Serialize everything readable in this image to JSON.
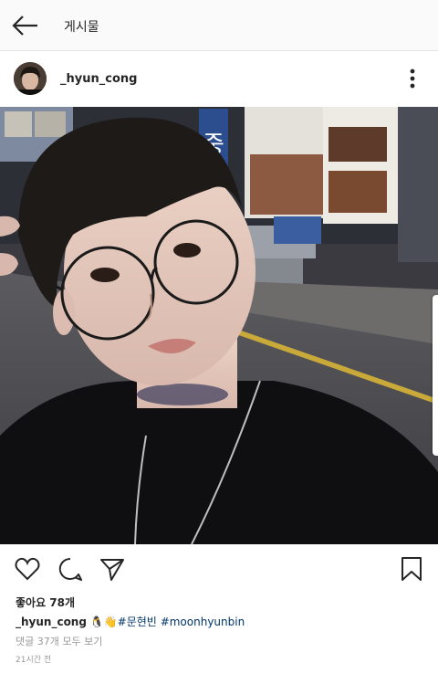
{
  "header": {
    "title": "게시물",
    "back_icon": "arrow-left-icon"
  },
  "post": {
    "username": "_hyun_cong",
    "more_icon": "more-vertical-icon",
    "photo_alt": "selfie photo",
    "shop_sign_text": "중",
    "likes": "좋아요 78개",
    "caption": {
      "username": "_hyun_cong",
      "emojis": "🐧👋",
      "hashtag1": "#문현빈",
      "hashtag2": "#moonhyunbin"
    },
    "comments_link": "댓글 37개 모두 보기",
    "timestamp": "21시간 전"
  },
  "actions": {
    "like_icon": "heart-icon",
    "comment_icon": "comment-icon",
    "share_icon": "send-icon",
    "save_icon": "bookmark-icon"
  },
  "colors": {
    "text": "#262626",
    "muted": "#999999",
    "hashtag": "#003569",
    "topbar_bg": "#fafafa"
  }
}
